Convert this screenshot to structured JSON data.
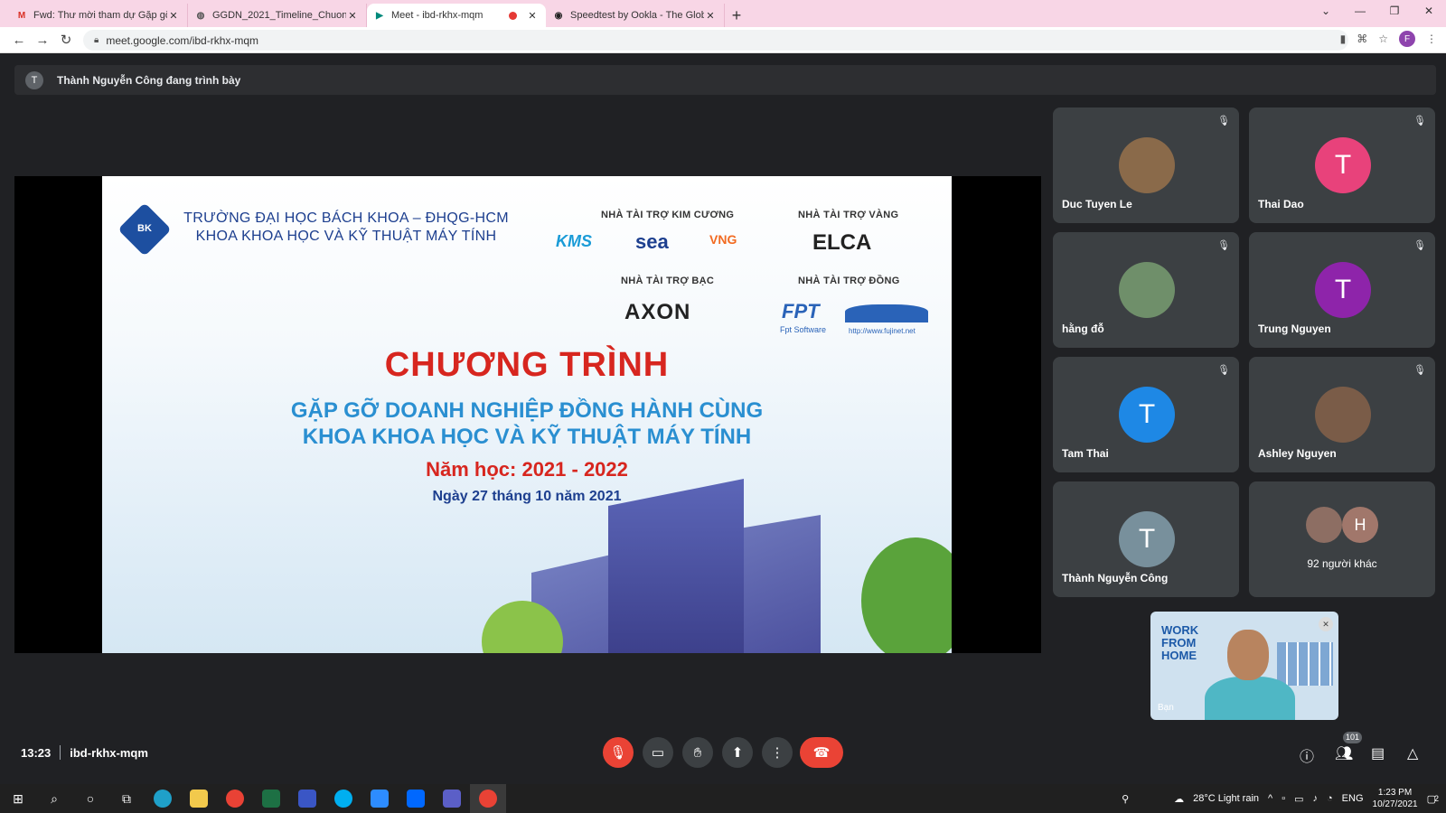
{
  "browser": {
    "tabs": [
      {
        "title": "Fwd: Thư mời tham dự Gặp gỡ D",
        "icon": "gmail-icon",
        "active": false
      },
      {
        "title": "GGDN_2021_Timeline_ChuongTr",
        "icon": "globe-icon",
        "active": false
      },
      {
        "title": "Meet - ibd-rkhx-mqm",
        "icon": "meet-icon",
        "active": true,
        "recording": true
      },
      {
        "title": "Speedtest by Ookla - The Global",
        "icon": "speedtest-icon",
        "active": false
      }
    ],
    "new_tab": "+",
    "url": "meet.google.com/ibd-rkhx-mqm",
    "profile_initial": "F"
  },
  "presenting": {
    "avatar": "T",
    "text": "Thành Nguyễn Công đang trình bày"
  },
  "slide": {
    "logo_text": "BK",
    "university_line1": "TRƯỜNG ĐẠI HỌC BÁCH KHOA – ĐHQG-HCM",
    "university_line2": "KHOA KHOA HỌC VÀ KỸ THUẬT MÁY TÍNH",
    "sponsors": {
      "diamond_heading": "NHÀ TÀI TRỢ KIM CƯƠNG",
      "diamond": [
        "KMS",
        "sea",
        "VNG"
      ],
      "gold_heading": "NHÀ TÀI TRỢ VÀNG",
      "gold": [
        "ELCA"
      ],
      "silver_heading": "NHÀ TÀI TRỢ BẠC",
      "silver": [
        "AXON"
      ],
      "bronze_heading": "NHÀ TÀI TRỢ ĐỒNG",
      "bronze": [
        "FPT",
        "Fpt Software",
        "http://www.fujinet.net"
      ]
    },
    "program": "CHƯƠNG TRÌNH",
    "subtitle1": "GẶP GỠ DOANH NGHIỆP ĐỒNG HÀNH CÙNG",
    "subtitle2": "KHOA KHOA HỌC VÀ KỸ THUẬT MÁY TÍNH",
    "school_year": "Năm học: 2021 - 2022",
    "date": "Ngày 27 tháng 10 năm 2021"
  },
  "participants": [
    {
      "name": "Duc Tuyen Le",
      "avatar": "photo",
      "color": "#8a6a4a",
      "muted": true
    },
    {
      "name": "Thai Dao",
      "avatar": "T",
      "color": "#e8427b",
      "muted": true
    },
    {
      "name": "hằng đỗ",
      "avatar": "photo",
      "color": "#6f8f6a",
      "muted": true
    },
    {
      "name": "Trung Nguyen",
      "avatar": "T",
      "color": "#8e24aa",
      "muted": true
    },
    {
      "name": "Tam Thai",
      "avatar": "T",
      "color": "#1e88e5",
      "muted": true
    },
    {
      "name": "Ashley Nguyen",
      "avatar": "photo",
      "color": "#7a5c48",
      "muted": true
    },
    {
      "name": "Thành Nguyễn Công",
      "avatar": "T",
      "color": "#78909c",
      "muted": false
    }
  ],
  "others": {
    "text": "92 người khác",
    "avatar2": "H",
    "avatar2_color": "#a1776b"
  },
  "self_view": {
    "label": "Bạn",
    "banner": "WORK FROM HOME"
  },
  "meeting": {
    "time": "13:23",
    "code": "ibd-rkhx-mqm",
    "people_count": "101"
  },
  "taskbar": {
    "weather": "28°C  Light rain",
    "lang": "ENG",
    "time": "1:23 PM",
    "date": "10/27/2021",
    "notifications": "2"
  }
}
